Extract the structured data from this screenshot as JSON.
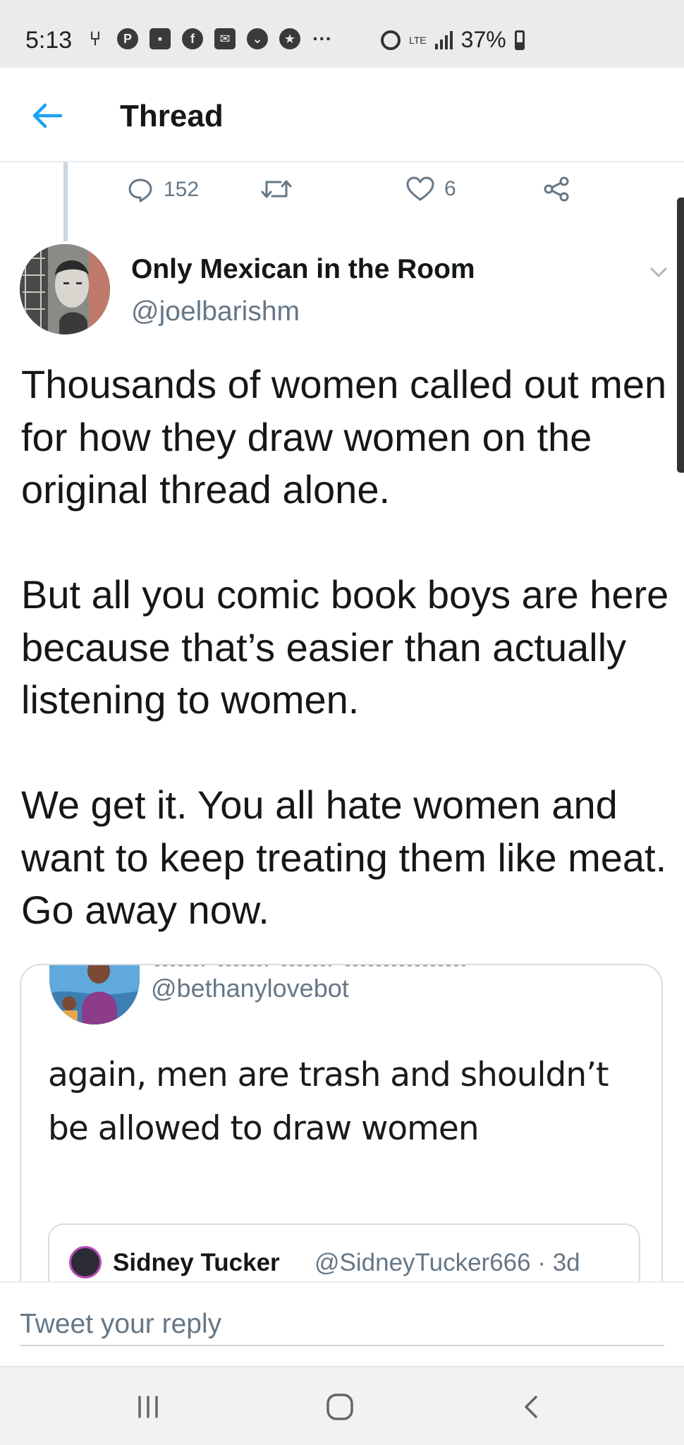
{
  "status_bar": {
    "time": "5:13",
    "network_label": "LTE",
    "battery": "37%",
    "more": "···"
  },
  "header": {
    "title": "Thread"
  },
  "previous_tweet_actions": {
    "replies": "152",
    "likes": "6"
  },
  "tweet": {
    "author_name": "Only Mexican in the Room",
    "author_handle": "@joelbarishm",
    "paragraphs": [
      "Thousands of women called out men for how they draw women on the original thread alone.",
      "But all you comic book boys are here because that’s easier than actually listening to women.",
      "We get it. You all hate women and want to keep treating them like meat. Go away now."
    ]
  },
  "quoted_tweet": {
    "handle": "@bethanylovebot",
    "text": "again, men are trash and shouldn’t be allowed to draw women",
    "inner": {
      "name": "Sidney Tucker",
      "meta": "@SidneyTucker666 · 3d"
    }
  },
  "reply": {
    "placeholder": "Tweet your reply"
  },
  "colors": {
    "accent": "#1da1f2",
    "secondary_text": "#657786",
    "primary_text": "#14171a",
    "status_bar_bg": "#ebebeb",
    "nav_bar_bg": "#f2f2f2"
  }
}
